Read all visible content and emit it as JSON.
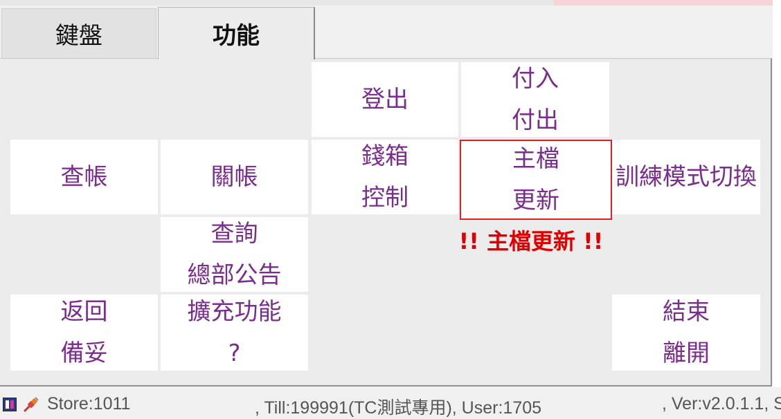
{
  "tabs": [
    {
      "label": "鍵盤",
      "active": false
    },
    {
      "label": "功能",
      "active": true
    }
  ],
  "buttons": {
    "logout": {
      "lines": [
        "登出"
      ]
    },
    "pay_in_out": {
      "lines": [
        "付入",
        "付出"
      ]
    },
    "check_bill": {
      "lines": [
        "查帳"
      ]
    },
    "close_bill": {
      "lines": [
        "關帳"
      ]
    },
    "cash_drawer": {
      "lines": [
        "錢箱",
        "控制"
      ]
    },
    "master_update": {
      "lines": [
        "主檔",
        "更新"
      ]
    },
    "training_mode": {
      "lines": [
        "訓練模式切換"
      ]
    },
    "hq_notice": {
      "lines": [
        "查詢",
        "總部公告"
      ]
    },
    "return_ready": {
      "lines": [
        "返回",
        "備妥"
      ]
    },
    "extensions": {
      "lines": [
        "擴充功能",
        "?"
      ]
    },
    "exit": {
      "lines": [
        "結束",
        "離開"
      ]
    }
  },
  "alert": {
    "text": "!! 主檔更新 !!"
  },
  "status": {
    "store": "Store:1011",
    "till": ", Till:199991(TC測試專用), User:1705",
    "version": ", Ver:v2.0.1.1, S"
  },
  "colors": {
    "button_text": "#7a2c8f",
    "alert": "#e00000",
    "highlight_border": "#e02020"
  },
  "icons": {
    "status_app": "app-icon",
    "status_connection": "plug-connection-icon"
  }
}
